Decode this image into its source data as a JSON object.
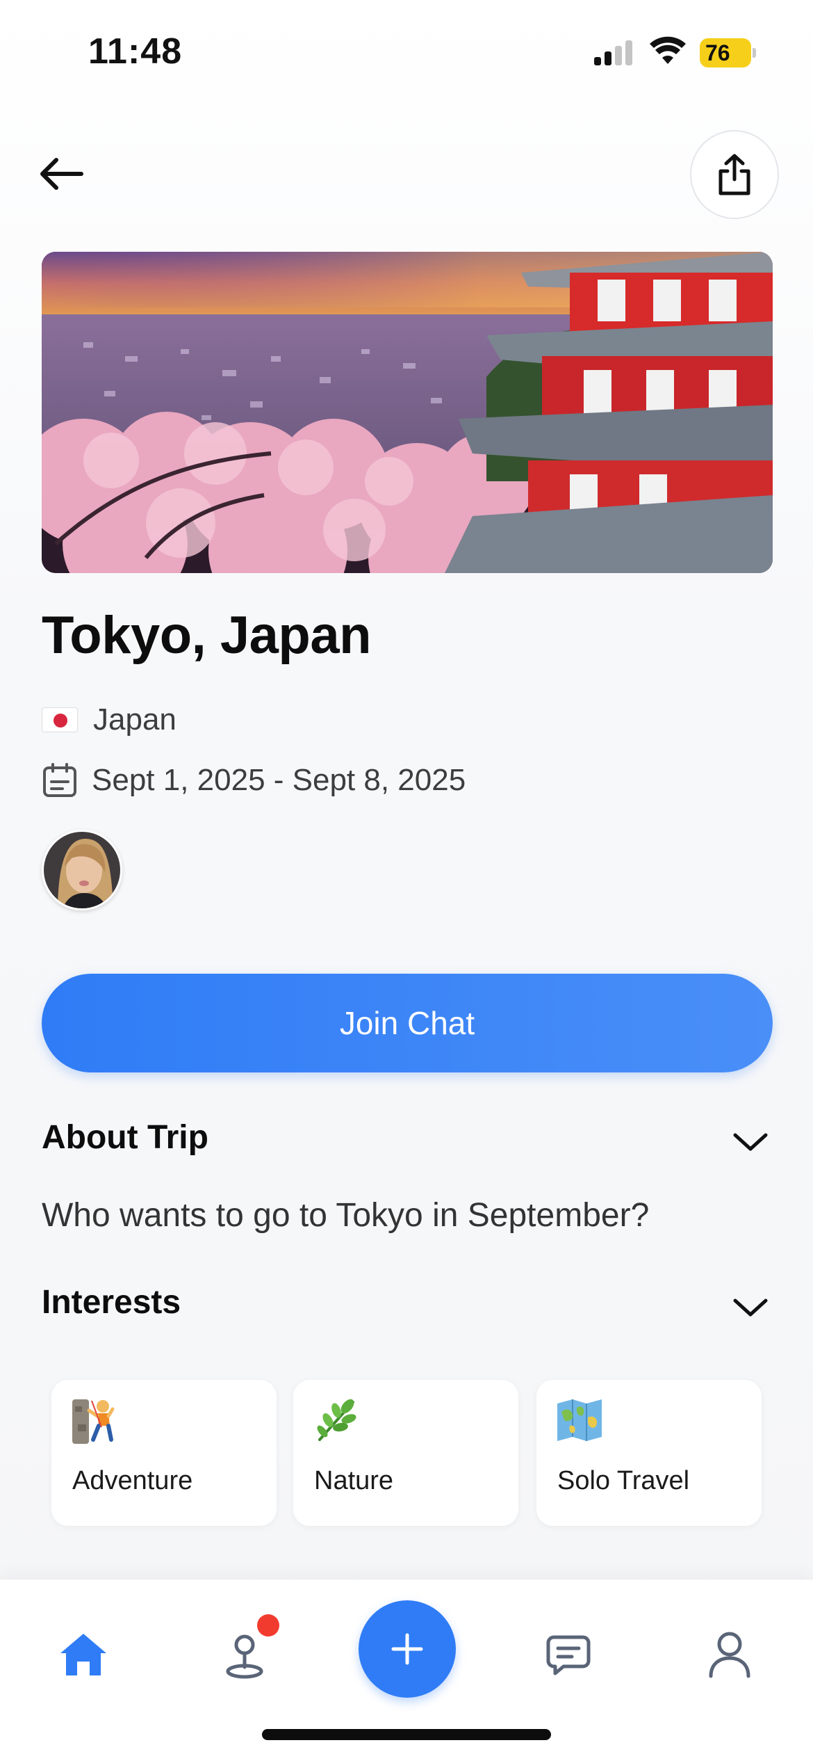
{
  "status_bar": {
    "time": "11:48",
    "battery": "76"
  },
  "header": {
    "back_icon": "arrow-left-icon",
    "share_icon": "share-icon"
  },
  "trip": {
    "title": "Tokyo, Japan",
    "country": "Japan",
    "dates": "Sept 1, 2025 - Sept 8, 2025"
  },
  "join_button": {
    "label": "Join Chat"
  },
  "about": {
    "heading": "About Trip",
    "body": "Who wants to go to Tokyo in September?"
  },
  "interests": {
    "heading": "Interests",
    "items": [
      {
        "label": "Adventure",
        "icon": "climber-icon"
      },
      {
        "label": "Nature",
        "icon": "herb-icon"
      },
      {
        "label": "Solo Travel",
        "icon": "map-icon"
      }
    ]
  },
  "tab_bar": {
    "items": [
      "home-icon",
      "location-pin-icon",
      "plus-icon",
      "chat-icon",
      "profile-icon"
    ],
    "active": "home-icon"
  },
  "colors": {
    "accent": "#2f7cf6",
    "notification": "#f23b2f",
    "battery": "#f6cf1a"
  }
}
